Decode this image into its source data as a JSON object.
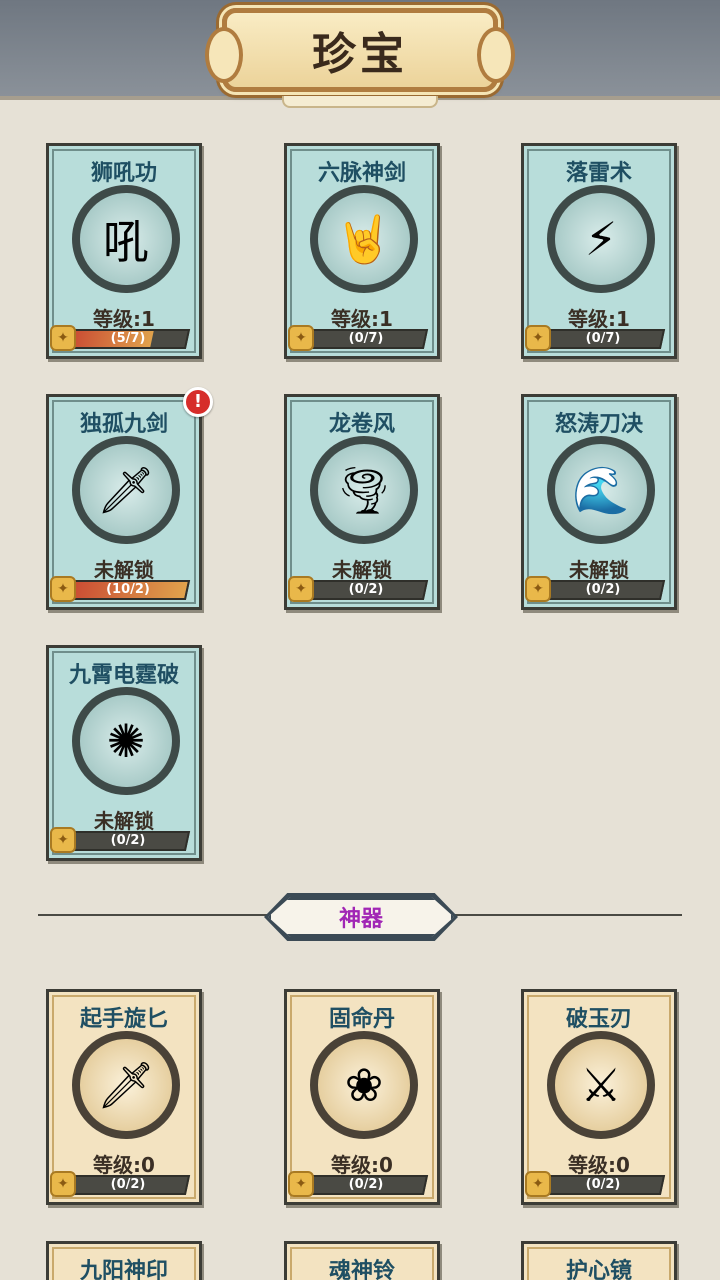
{
  "header": {
    "title": "珍宝"
  },
  "sections": {
    "artifacts_label": "神器"
  },
  "skills": [
    {
      "name": "狮吼功",
      "icon": "roar-icon",
      "glyph": "吼",
      "status": "等级:1",
      "progress": "(5/7)",
      "fill": 0.71
    },
    {
      "name": "六脉神剑",
      "icon": "finger-sword-icon",
      "glyph": "🤘",
      "status": "等级:1",
      "progress": "(0/7)",
      "fill": 0
    },
    {
      "name": "落雷术",
      "icon": "lightning-icon",
      "glyph": "⚡",
      "status": "等级:1",
      "progress": "(0/7)",
      "fill": 0
    },
    {
      "name": "独孤九剑",
      "icon": "nine-swords-icon",
      "glyph": "🗡",
      "status": "未解锁",
      "progress": "(10/2)",
      "fill": 1,
      "alert": "!"
    },
    {
      "name": "龙卷风",
      "icon": "tornado-icon",
      "glyph": "🌪",
      "status": "未解锁",
      "progress": "(0/2)",
      "fill": 0
    },
    {
      "name": "怒涛刀决",
      "icon": "wave-blade-icon",
      "glyph": "🌊",
      "status": "未解锁",
      "progress": "(0/2)",
      "fill": 0
    },
    {
      "name": "九霄电霆破",
      "icon": "thunder-orb-icon",
      "glyph": "✺",
      "status": "未解锁",
      "progress": "(0/2)",
      "fill": 0
    }
  ],
  "artifacts": [
    {
      "name": "起手旋匕",
      "icon": "spin-dagger-icon",
      "glyph": "🗡",
      "status": "等级:0",
      "progress": "(0/2)",
      "fill": 0
    },
    {
      "name": "固命丹",
      "icon": "pill-icon",
      "glyph": "❀",
      "status": "等级:0",
      "progress": "(0/2)",
      "fill": 0
    },
    {
      "name": "破玉刃",
      "icon": "jade-blade-icon",
      "glyph": "⚔",
      "status": "等级:0",
      "progress": "(0/2)",
      "fill": 0
    },
    {
      "name": "九阳神印"
    },
    {
      "name": "魂神铃"
    },
    {
      "name": "护心镜"
    }
  ],
  "colors": {
    "skill_card": "#b8ddda",
    "artifact_card": "#f3e3c1",
    "section_label": "#a126b5",
    "progress_fill": "#e0a24c"
  }
}
